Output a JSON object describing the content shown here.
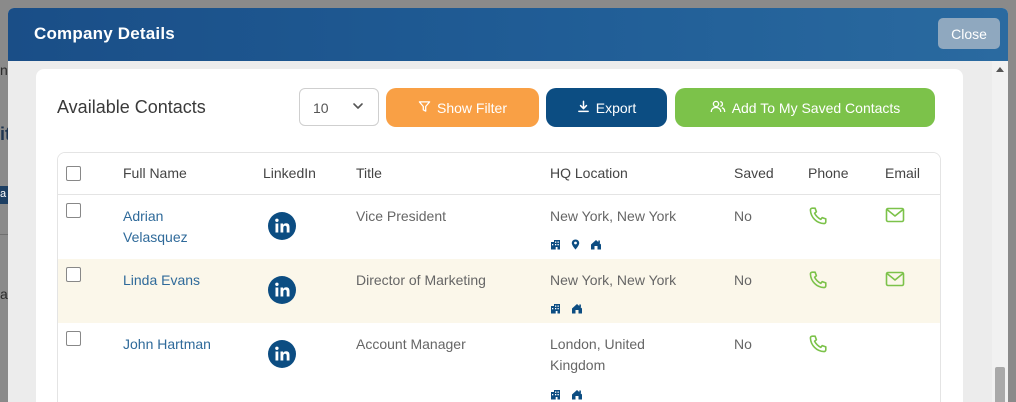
{
  "modal": {
    "title": "Company Details",
    "close_label": "Close"
  },
  "backdrop": {
    "frag1": "n",
    "frag2": "it",
    "frag3": "a",
    "frag4": "a"
  },
  "toolbar": {
    "title": "Available Contacts",
    "page_size": "10",
    "show_filter_label": "Show Filter",
    "export_label": "Export",
    "add_saved_label": "Add To My Saved Contacts"
  },
  "table": {
    "headers": {
      "full_name": "Full Name",
      "linkedin": "LinkedIn",
      "title": "Title",
      "hq_location": "HQ Location",
      "saved": "Saved",
      "phone": "Phone",
      "email": "Email"
    },
    "rows": [
      {
        "name_line1": "Adrian",
        "name_line2": "Velasquez",
        "title": "Vice President",
        "location_line1": "New York, New York",
        "location_line2": "",
        "location_icons": [
          "building-icon",
          "map-pin-icon",
          "home-icon"
        ],
        "saved": "No",
        "has_phone": true,
        "has_email": true
      },
      {
        "name_line1": "Linda Evans",
        "name_line2": "",
        "title": "Director of Marketing",
        "location_line1": "New York, New York",
        "location_line2": "",
        "location_icons": [
          "building-icon",
          "home-icon"
        ],
        "saved": "No",
        "has_phone": true,
        "has_email": true
      },
      {
        "name_line1": "John Hartman",
        "name_line2": "",
        "title": "Account Manager",
        "location_line1": "London, United",
        "location_line2": "Kingdom",
        "location_icons": [
          "building-icon",
          "home-icon"
        ],
        "saved": "No",
        "has_phone": true,
        "has_email": false
      }
    ]
  },
  "colors": {
    "header_blue": "#1a4e87",
    "filter_orange": "#f9a045",
    "export_navy": "#0c4d82",
    "add_green": "#7cc24a",
    "link_blue": "#2f6a9a",
    "icon_green": "#7cc24a",
    "row_highlight": "#fbf7ea"
  }
}
